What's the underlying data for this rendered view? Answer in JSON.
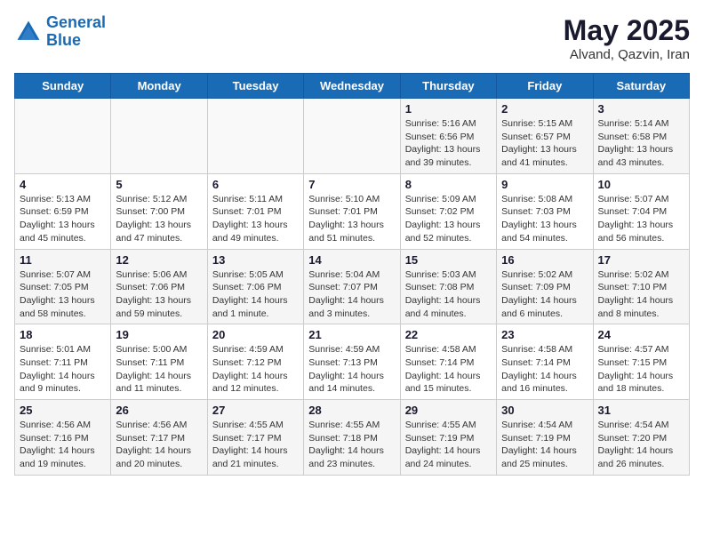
{
  "header": {
    "logo_line1": "General",
    "logo_line2": "Blue",
    "month": "May 2025",
    "location": "Alvand, Qazvin, Iran"
  },
  "days_of_week": [
    "Sunday",
    "Monday",
    "Tuesday",
    "Wednesday",
    "Thursday",
    "Friday",
    "Saturday"
  ],
  "weeks": [
    [
      {
        "day": "",
        "info": ""
      },
      {
        "day": "",
        "info": ""
      },
      {
        "day": "",
        "info": ""
      },
      {
        "day": "",
        "info": ""
      },
      {
        "day": "1",
        "info": "Sunrise: 5:16 AM\nSunset: 6:56 PM\nDaylight: 13 hours and 39 minutes."
      },
      {
        "day": "2",
        "info": "Sunrise: 5:15 AM\nSunset: 6:57 PM\nDaylight: 13 hours and 41 minutes."
      },
      {
        "day": "3",
        "info": "Sunrise: 5:14 AM\nSunset: 6:58 PM\nDaylight: 13 hours and 43 minutes."
      }
    ],
    [
      {
        "day": "4",
        "info": "Sunrise: 5:13 AM\nSunset: 6:59 PM\nDaylight: 13 hours and 45 minutes."
      },
      {
        "day": "5",
        "info": "Sunrise: 5:12 AM\nSunset: 7:00 PM\nDaylight: 13 hours and 47 minutes."
      },
      {
        "day": "6",
        "info": "Sunrise: 5:11 AM\nSunset: 7:01 PM\nDaylight: 13 hours and 49 minutes."
      },
      {
        "day": "7",
        "info": "Sunrise: 5:10 AM\nSunset: 7:01 PM\nDaylight: 13 hours and 51 minutes."
      },
      {
        "day": "8",
        "info": "Sunrise: 5:09 AM\nSunset: 7:02 PM\nDaylight: 13 hours and 52 minutes."
      },
      {
        "day": "9",
        "info": "Sunrise: 5:08 AM\nSunset: 7:03 PM\nDaylight: 13 hours and 54 minutes."
      },
      {
        "day": "10",
        "info": "Sunrise: 5:07 AM\nSunset: 7:04 PM\nDaylight: 13 hours and 56 minutes."
      }
    ],
    [
      {
        "day": "11",
        "info": "Sunrise: 5:07 AM\nSunset: 7:05 PM\nDaylight: 13 hours and 58 minutes."
      },
      {
        "day": "12",
        "info": "Sunrise: 5:06 AM\nSunset: 7:06 PM\nDaylight: 13 hours and 59 minutes."
      },
      {
        "day": "13",
        "info": "Sunrise: 5:05 AM\nSunset: 7:06 PM\nDaylight: 14 hours and 1 minute."
      },
      {
        "day": "14",
        "info": "Sunrise: 5:04 AM\nSunset: 7:07 PM\nDaylight: 14 hours and 3 minutes."
      },
      {
        "day": "15",
        "info": "Sunrise: 5:03 AM\nSunset: 7:08 PM\nDaylight: 14 hours and 4 minutes."
      },
      {
        "day": "16",
        "info": "Sunrise: 5:02 AM\nSunset: 7:09 PM\nDaylight: 14 hours and 6 minutes."
      },
      {
        "day": "17",
        "info": "Sunrise: 5:02 AM\nSunset: 7:10 PM\nDaylight: 14 hours and 8 minutes."
      }
    ],
    [
      {
        "day": "18",
        "info": "Sunrise: 5:01 AM\nSunset: 7:11 PM\nDaylight: 14 hours and 9 minutes."
      },
      {
        "day": "19",
        "info": "Sunrise: 5:00 AM\nSunset: 7:11 PM\nDaylight: 14 hours and 11 minutes."
      },
      {
        "day": "20",
        "info": "Sunrise: 4:59 AM\nSunset: 7:12 PM\nDaylight: 14 hours and 12 minutes."
      },
      {
        "day": "21",
        "info": "Sunrise: 4:59 AM\nSunset: 7:13 PM\nDaylight: 14 hours and 14 minutes."
      },
      {
        "day": "22",
        "info": "Sunrise: 4:58 AM\nSunset: 7:14 PM\nDaylight: 14 hours and 15 minutes."
      },
      {
        "day": "23",
        "info": "Sunrise: 4:58 AM\nSunset: 7:14 PM\nDaylight: 14 hours and 16 minutes."
      },
      {
        "day": "24",
        "info": "Sunrise: 4:57 AM\nSunset: 7:15 PM\nDaylight: 14 hours and 18 minutes."
      }
    ],
    [
      {
        "day": "25",
        "info": "Sunrise: 4:56 AM\nSunset: 7:16 PM\nDaylight: 14 hours and 19 minutes."
      },
      {
        "day": "26",
        "info": "Sunrise: 4:56 AM\nSunset: 7:17 PM\nDaylight: 14 hours and 20 minutes."
      },
      {
        "day": "27",
        "info": "Sunrise: 4:55 AM\nSunset: 7:17 PM\nDaylight: 14 hours and 21 minutes."
      },
      {
        "day": "28",
        "info": "Sunrise: 4:55 AM\nSunset: 7:18 PM\nDaylight: 14 hours and 23 minutes."
      },
      {
        "day": "29",
        "info": "Sunrise: 4:55 AM\nSunset: 7:19 PM\nDaylight: 14 hours and 24 minutes."
      },
      {
        "day": "30",
        "info": "Sunrise: 4:54 AM\nSunset: 7:19 PM\nDaylight: 14 hours and 25 minutes."
      },
      {
        "day": "31",
        "info": "Sunrise: 4:54 AM\nSunset: 7:20 PM\nDaylight: 14 hours and 26 minutes."
      }
    ]
  ]
}
